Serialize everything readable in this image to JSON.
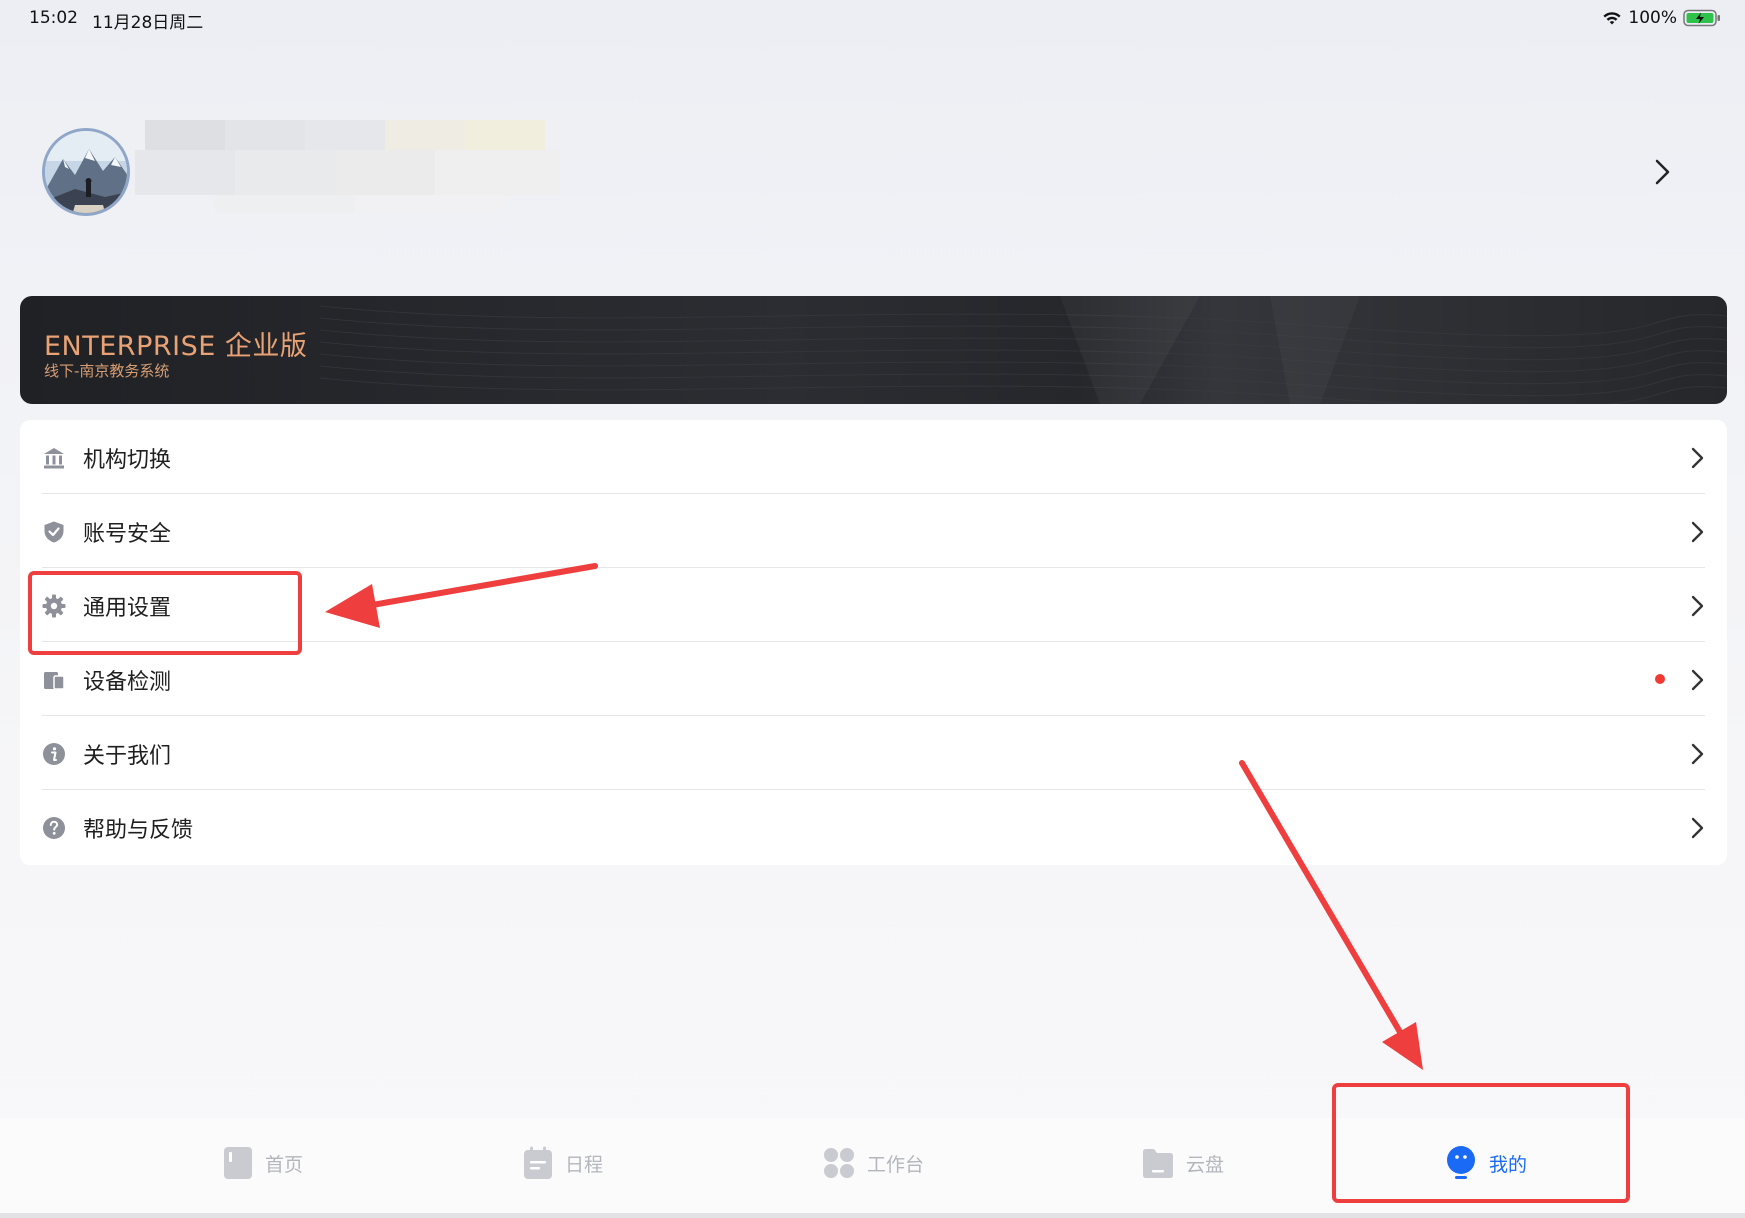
{
  "status_bar": {
    "time": "15:02",
    "date": "11月28日周二",
    "battery": "100%"
  },
  "profile": {
    "avatar_icon": "avatar-mountain-photo",
    "chevron_icon": "chevron-right-icon"
  },
  "enterprise": {
    "title": "ENTERPRISE 企业版",
    "subtitle": "线下-南京教务系统"
  },
  "menu": {
    "items": [
      {
        "label": "机构切换",
        "icon": "institution-icon"
      },
      {
        "label": "账号安全",
        "icon": "shield-icon"
      },
      {
        "label": "通用设置",
        "icon": "gear-icon"
      },
      {
        "label": "设备检测",
        "icon": "device-icon"
      },
      {
        "label": "关于我们",
        "icon": "info-icon"
      },
      {
        "label": "帮助与反馈",
        "icon": "help-icon"
      }
    ]
  },
  "tabbar": {
    "tabs": [
      {
        "label": "首页",
        "icon": "home-icon",
        "active": false
      },
      {
        "label": "日程",
        "icon": "calendar-icon",
        "active": false
      },
      {
        "label": "工作台",
        "icon": "workbench-icon",
        "active": false
      },
      {
        "label": "云盘",
        "icon": "folder-icon",
        "active": false
      },
      {
        "label": "我的",
        "icon": "profile-face-icon",
        "active": true
      }
    ]
  },
  "colors": {
    "accent": "#1b6af5",
    "enterprise_text": "#e9a274",
    "annotation": "#ee3e3d",
    "badge": "#f23a33"
  }
}
